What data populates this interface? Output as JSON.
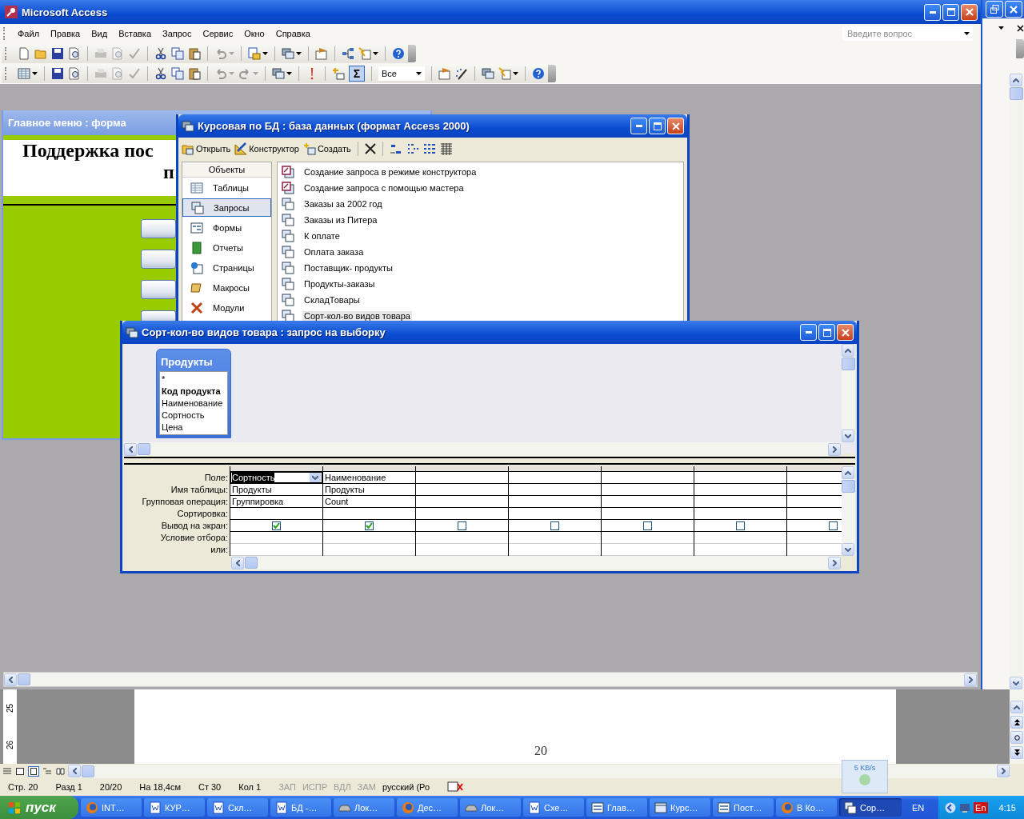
{
  "access": {
    "title": "Microsoft Access",
    "menu": [
      {
        "label": "Файл"
      },
      {
        "label": "Правка"
      },
      {
        "label": "Вид"
      },
      {
        "label": "Вставка"
      },
      {
        "label": "Запрос"
      },
      {
        "label": "Сервис"
      },
      {
        "label": "Окно"
      },
      {
        "label": "Справка"
      }
    ],
    "help_placeholder": "Введите вопрос",
    "totals_button": {
      "label": "Σ",
      "pressed": true
    },
    "filter_combo": {
      "value": "Все"
    }
  },
  "form_window": {
    "title": "Главное меню : форма",
    "heading": [
      "Поддержка пос",
      "п"
    ]
  },
  "db_window": {
    "title": "Курсовая по БД : база данных (формат Access 2000)",
    "actions": [
      {
        "label": "Открыть",
        "kind": "open"
      },
      {
        "label": "Конструктор",
        "kind": "design"
      },
      {
        "label": "Создать",
        "kind": "new"
      }
    ],
    "objects_header": "Объекты",
    "objects": [
      {
        "label": "Таблицы",
        "kind": "table",
        "selected": false
      },
      {
        "label": "Запросы",
        "kind": "query",
        "selected": true
      },
      {
        "label": "Формы",
        "kind": "form",
        "selected": false
      },
      {
        "label": "Отчеты",
        "kind": "report",
        "selected": false
      },
      {
        "label": "Страницы",
        "kind": "page",
        "selected": false
      },
      {
        "label": "Макросы",
        "kind": "macro",
        "selected": false
      },
      {
        "label": "Модули",
        "kind": "module",
        "selected": false
      }
    ],
    "items": [
      {
        "label": "Создание запроса в режиме конструктора",
        "kind": "wizard",
        "selected": false
      },
      {
        "label": "Создание запроса с помощью мастера",
        "kind": "wizard",
        "selected": false
      },
      {
        "label": "Заказы за 2002 год",
        "kind": "query",
        "selected": false
      },
      {
        "label": "Заказы из Питера",
        "kind": "query",
        "selected": false
      },
      {
        "label": "К оплате",
        "kind": "query",
        "selected": false
      },
      {
        "label": "Оплата заказа",
        "kind": "query",
        "selected": false
      },
      {
        "label": "Поставщик- продукты",
        "kind": "query",
        "selected": false
      },
      {
        "label": "Продукты-заказы",
        "kind": "query",
        "selected": false
      },
      {
        "label": "СкладТовары",
        "kind": "query",
        "selected": false
      },
      {
        "label": "Сорт-кол-во видов товара",
        "kind": "query",
        "selected": true
      }
    ]
  },
  "query_window": {
    "title": "Сорт-кол-во видов товара : запрос на выборку",
    "table": {
      "name": "Продукты",
      "fields": [
        {
          "label": "*",
          "key": false
        },
        {
          "label": "Код продукта",
          "key": true
        },
        {
          "label": "Наименование",
          "key": false
        },
        {
          "label": "Сортность",
          "key": false
        },
        {
          "label": "Цена",
          "key": false
        }
      ]
    },
    "row_labels": [
      "Поле:",
      "Имя таблицы:",
      "Групповая операция:",
      "Сортировка:",
      "Вывод на экран:",
      "Условие отбора:",
      "или:"
    ],
    "columns": [
      {
        "field": "Сортность",
        "table": "Продукты",
        "total": "Группировка",
        "show": true,
        "selected": true
      },
      {
        "field": "Наименование",
        "table": "Продукты",
        "total": "Count",
        "show": true,
        "selected": false
      },
      {
        "show": false,
        "selected": false
      },
      {
        "show": false,
        "selected": false
      },
      {
        "show": false,
        "selected": false
      },
      {
        "show": false,
        "selected": false
      },
      {
        "show": false,
        "selected": false
      }
    ]
  },
  "word": {
    "ruler": [
      "25",
      "26"
    ],
    "page_number": "20",
    "status": [
      {
        "label": "Стр. 20",
        "disabled": false
      },
      {
        "label": "Разд 1",
        "disabled": false
      },
      {
        "label": "20/20",
        "disabled": false
      },
      {
        "label": "На 18,4см",
        "disabled": false
      },
      {
        "label": "Ст 30",
        "disabled": false
      },
      {
        "label": "Кол 1",
        "disabled": false
      },
      {
        "label": "ЗАП",
        "disabled": true
      },
      {
        "label": "ИСПР",
        "disabled": true
      },
      {
        "label": "ВДЛ",
        "disabled": true
      },
      {
        "label": "ЗАМ",
        "disabled": true
      },
      {
        "label": "русский (Ро",
        "disabled": false
      }
    ],
    "network_speed": "5 KB/s"
  },
  "taskbar": {
    "start": "пуск",
    "buttons": [
      {
        "label": "INT…",
        "kind": "browser",
        "selected": false
      },
      {
        "label": "КУР…",
        "kind": "word",
        "selected": false
      },
      {
        "label": "Скл…",
        "kind": "word",
        "selected": false
      },
      {
        "label": "БД -…",
        "kind": "word",
        "selected": false
      },
      {
        "label": "Лок…",
        "kind": "drive",
        "selected": false
      },
      {
        "label": "Дес…",
        "kind": "browser",
        "selected": false
      },
      {
        "label": "Лок…",
        "kind": "drive",
        "selected": false
      },
      {
        "label": "Схе…",
        "kind": "word",
        "selected": false
      },
      {
        "label": "Глав…",
        "kind": "form",
        "selected": false
      },
      {
        "label": "Курс…",
        "kind": "database",
        "selected": false
      },
      {
        "label": "Пост…",
        "kind": "form",
        "selected": false
      },
      {
        "label": "В Ко…",
        "kind": "browser",
        "selected": false
      },
      {
        "label": "Сор…",
        "kind": "query",
        "selected": true
      }
    ],
    "language": "EN",
    "tray_language": "En",
    "clock": "4:15"
  }
}
